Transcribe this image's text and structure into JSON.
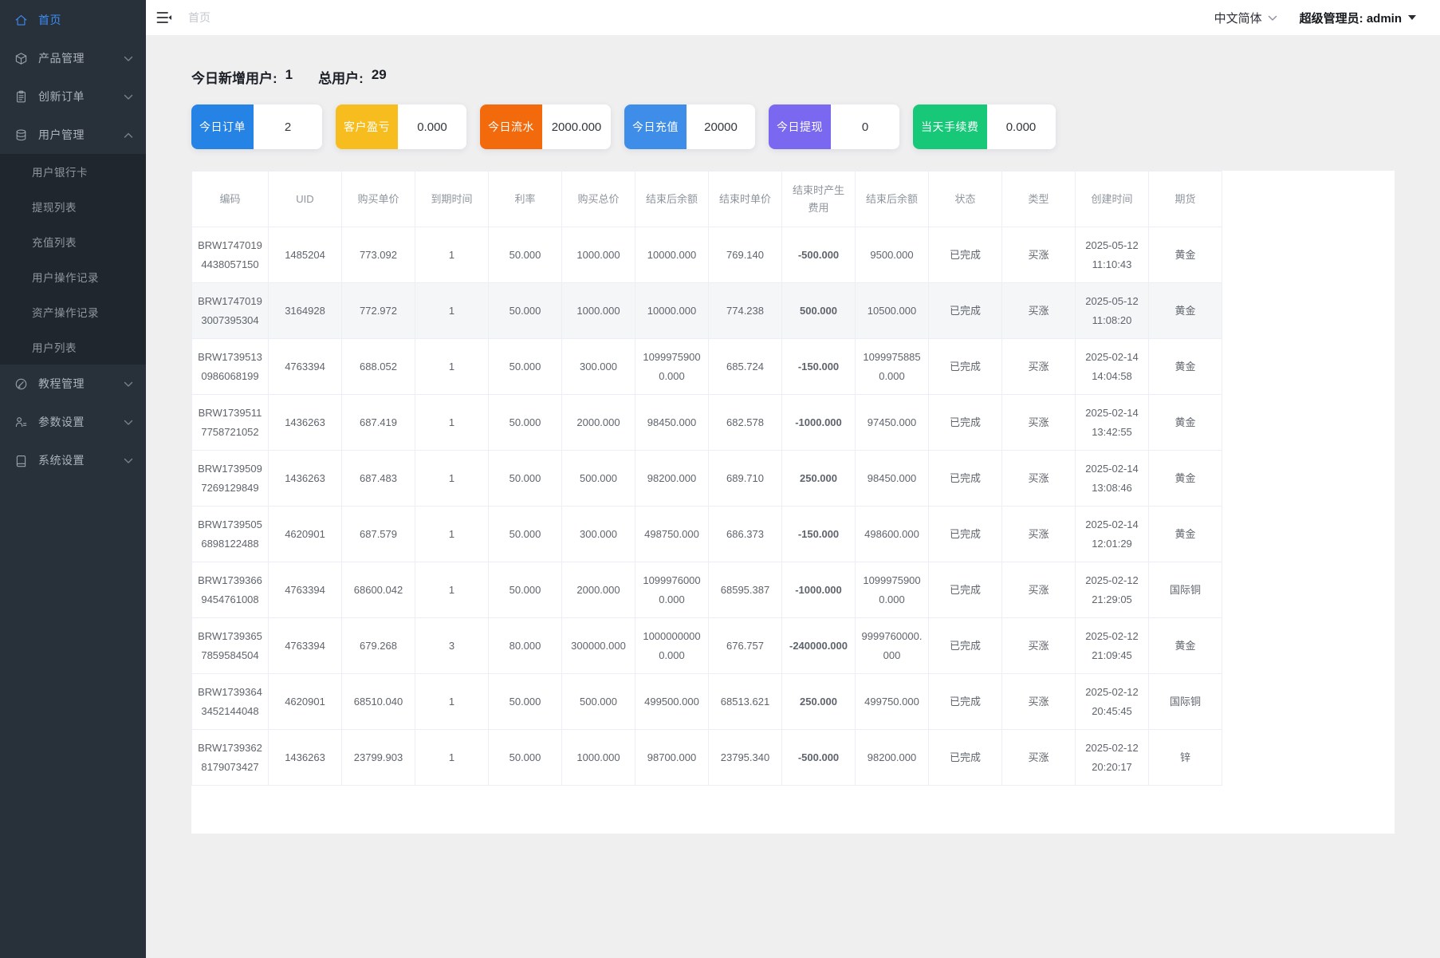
{
  "sidebar": {
    "items": [
      {
        "name": "home",
        "label": "首页",
        "icon": "home-icon",
        "active": true
      },
      {
        "name": "product-manage",
        "label": "产品管理",
        "icon": "cube-icon",
        "chevron": "down"
      },
      {
        "name": "innovation-orders",
        "label": "创新订单",
        "icon": "clipboard-icon",
        "chevron": "down"
      },
      {
        "name": "user-manage",
        "label": "用户管理",
        "icon": "database-icon",
        "chevron": "up",
        "children": [
          {
            "name": "user-bank-cards",
            "label": "用户银行卡"
          },
          {
            "name": "withdraw-list",
            "label": "提现列表"
          },
          {
            "name": "recharge-list",
            "label": "充值列表"
          },
          {
            "name": "user-op-records",
            "label": "用户操作记录"
          },
          {
            "name": "asset-op-records",
            "label": "资产操作记录"
          },
          {
            "name": "user-list",
            "label": "用户列表"
          }
        ]
      },
      {
        "name": "tutorial-manage",
        "label": "教程管理",
        "icon": "edit-circle-icon",
        "chevron": "down"
      },
      {
        "name": "param-settings",
        "label": "参数设置",
        "icon": "user-settings-icon",
        "chevron": "down"
      },
      {
        "name": "system-settings",
        "label": "系统设置",
        "icon": "book-icon",
        "chevron": "down"
      }
    ]
  },
  "header": {
    "breadcrumb": "首页",
    "language": "中文简体",
    "user": "超级管理员: admin"
  },
  "stats": {
    "new_users_label": "今日新增用户:",
    "new_users_value": "1",
    "total_users_label": "总用户:",
    "total_users_value": "29"
  },
  "cards": [
    {
      "name": "today-orders",
      "label": "今日订单",
      "value": "2",
      "color": "#2583e5"
    },
    {
      "name": "customer-pnl",
      "label": "客户盈亏",
      "value": "0.000",
      "color": "#f7bd1f"
    },
    {
      "name": "today-flow",
      "label": "今日流水",
      "value": "2000.000",
      "color": "#f26a0c"
    },
    {
      "name": "today-recharge",
      "label": "今日充值",
      "value": "20000",
      "color": "#3e8de8"
    },
    {
      "name": "today-withdraw",
      "label": "今日提现",
      "value": "0",
      "color": "#7a68f0"
    },
    {
      "name": "today-fee",
      "label": "当天手续费",
      "value": "0.000",
      "color": "#16c878"
    }
  ],
  "table": {
    "columns": [
      "编码",
      "UID",
      "购买单价",
      "到期时间",
      "利率",
      "购买总价",
      "结束后余额",
      "结束时单价",
      "结束时产生费用",
      "结束后余额",
      "状态",
      "类型",
      "创建时间",
      "期货"
    ],
    "fee_column_index": 8,
    "fee_colors": {
      "negative": "#009b00",
      "positive": "#e90000"
    },
    "highlighted_row": 2,
    "rows": [
      [
        "BRW17470194438057150",
        "1485204",
        "773.092",
        "1",
        "50.000",
        "1000.000",
        "10000.000",
        "769.140",
        "-500.000",
        "9500.000",
        "已完成",
        "买涨",
        "2025-05-12 11:10:43",
        "黄金"
      ],
      [
        "BRW17470193007395304",
        "3164928",
        "772.972",
        "1",
        "50.000",
        "1000.000",
        "10000.000",
        "774.238",
        "500.000",
        "10500.000",
        "已完成",
        "买涨",
        "2025-05-12 11:08:20",
        "黄金"
      ],
      [
        "BRW17395130986068199",
        "4763394",
        "688.052",
        "1",
        "50.000",
        "300.000",
        "10999759000.000",
        "685.724",
        "-150.000",
        "10999758850.000",
        "已完成",
        "买涨",
        "2025-02-14 14:04:58",
        "黄金"
      ],
      [
        "BRW17395117758721052",
        "1436263",
        "687.419",
        "1",
        "50.000",
        "2000.000",
        "98450.000",
        "682.578",
        "-1000.000",
        "97450.000",
        "已完成",
        "买涨",
        "2025-02-14 13:42:55",
        "黄金"
      ],
      [
        "BRW17395097269129849",
        "1436263",
        "687.483",
        "1",
        "50.000",
        "500.000",
        "98200.000",
        "689.710",
        "250.000",
        "98450.000",
        "已完成",
        "买涨",
        "2025-02-14 13:08:46",
        "黄金"
      ],
      [
        "BRW17395056898122488",
        "4620901",
        "687.579",
        "1",
        "50.000",
        "300.000",
        "498750.000",
        "686.373",
        "-150.000",
        "498600.000",
        "已完成",
        "买涨",
        "2025-02-14 12:01:29",
        "黄金"
      ],
      [
        "BRW17393669454761008",
        "4763394",
        "68600.042",
        "1",
        "50.000",
        "2000.000",
        "10999760000.000",
        "68595.387",
        "-1000.000",
        "10999759000.000",
        "已完成",
        "买涨",
        "2025-02-12 21:29:05",
        "国际铜"
      ],
      [
        "BRW17393657859584504",
        "4763394",
        "679.268",
        "3",
        "80.000",
        "300000.000",
        "10000000000.000",
        "676.757",
        "-240000.000",
        "9999760000.000",
        "已完成",
        "买涨",
        "2025-02-12 21:09:45",
        "黄金"
      ],
      [
        "BRW17393643452144048",
        "4620901",
        "68510.040",
        "1",
        "50.000",
        "500.000",
        "499500.000",
        "68513.621",
        "250.000",
        "499750.000",
        "已完成",
        "买涨",
        "2025-02-12 20:45:45",
        "国际铜"
      ],
      [
        "BRW17393628179073427",
        "1436263",
        "23799.903",
        "1",
        "50.000",
        "1000.000",
        "98700.000",
        "23795.340",
        "-500.000",
        "98200.000",
        "已完成",
        "买涨",
        "2025-02-12 20:20:17",
        "锌"
      ]
    ]
  }
}
